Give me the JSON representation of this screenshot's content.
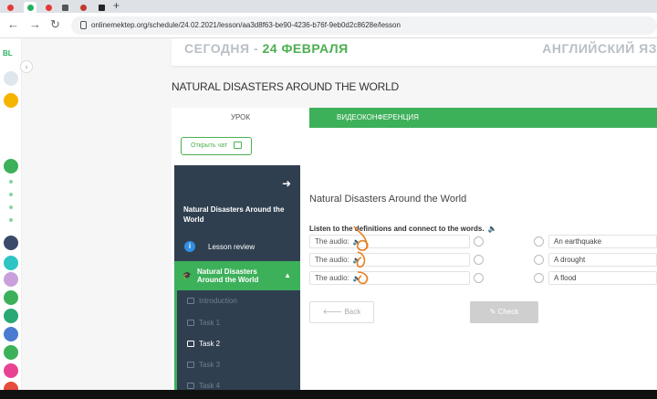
{
  "browser": {
    "url": "onlinemektep.org/schedule/24.02.2021/lesson/aa3d8f63-be90-4236-b76f-9eb0d2c8628e/lesson",
    "new_tab": "+"
  },
  "appbar": {
    "logo": "BL"
  },
  "header": {
    "date_prefix": "СЕГОДНЯ - ",
    "date": "24 ФЕВРАЛЯ",
    "subject": "АНГЛИЙСКИЙ ЯЗ"
  },
  "lesson_title": "NATURAL DISASTERS AROUND THE WORLD",
  "tabs": {
    "lesson": "УРОК",
    "video": "ВИДЕОКОНФЕРЕНЦИЯ"
  },
  "chat_button": "Открыть чат",
  "nav": {
    "title": "Natural Disasters Around the World",
    "review": "Lesson review",
    "active_section": "Natural Disasters Around the World",
    "items": [
      "Introduction",
      "Task 1",
      "Task 2",
      "Task 3",
      "Task 4"
    ]
  },
  "content": {
    "title": "Natural Disasters Around the World",
    "instruction": "Listen to the definitions and connect to the words.",
    "audio_label": "The audio:",
    "answers": [
      "An earthquake",
      "A drought",
      "A flood"
    ],
    "back_label": "Back",
    "check_label": "Check"
  },
  "colors": {
    "accent": "#3db05a",
    "nav_bg": "#2f3f4f",
    "annotation": "#e67e22"
  }
}
